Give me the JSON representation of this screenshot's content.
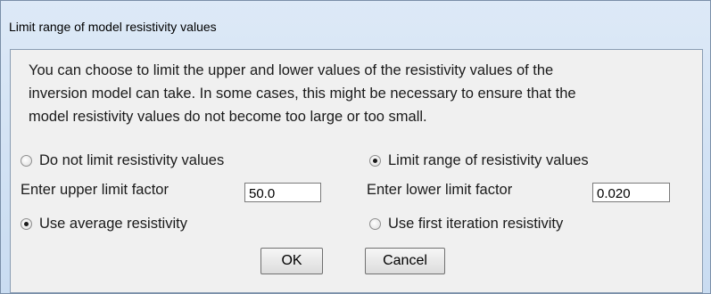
{
  "window": {
    "title": "Limit range of model resistivity values"
  },
  "description": {
    "lines": [
      "You can choose to limit the upper and lower values of the resistivity values of the",
      "inversion model can take. In some cases, this might be necessary to ensure that the",
      "model resistivity values do not become too large or too small."
    ]
  },
  "limit_mode": {
    "options": [
      {
        "label": "Do not limit resistivity values",
        "selected": false
      },
      {
        "label": "Limit range of resistivity values",
        "selected": true
      }
    ]
  },
  "upper_limit": {
    "label": "Enter upper limit factor",
    "value": "50.0"
  },
  "lower_limit": {
    "label": "Enter lower limit factor",
    "value": "0.020"
  },
  "reference_mode": {
    "options": [
      {
        "label": "Use average resistivity",
        "selected": true
      },
      {
        "label": "Use first iteration resistivity",
        "selected": false
      }
    ]
  },
  "buttons": {
    "ok_label": "OK",
    "cancel_label": "Cancel"
  }
}
